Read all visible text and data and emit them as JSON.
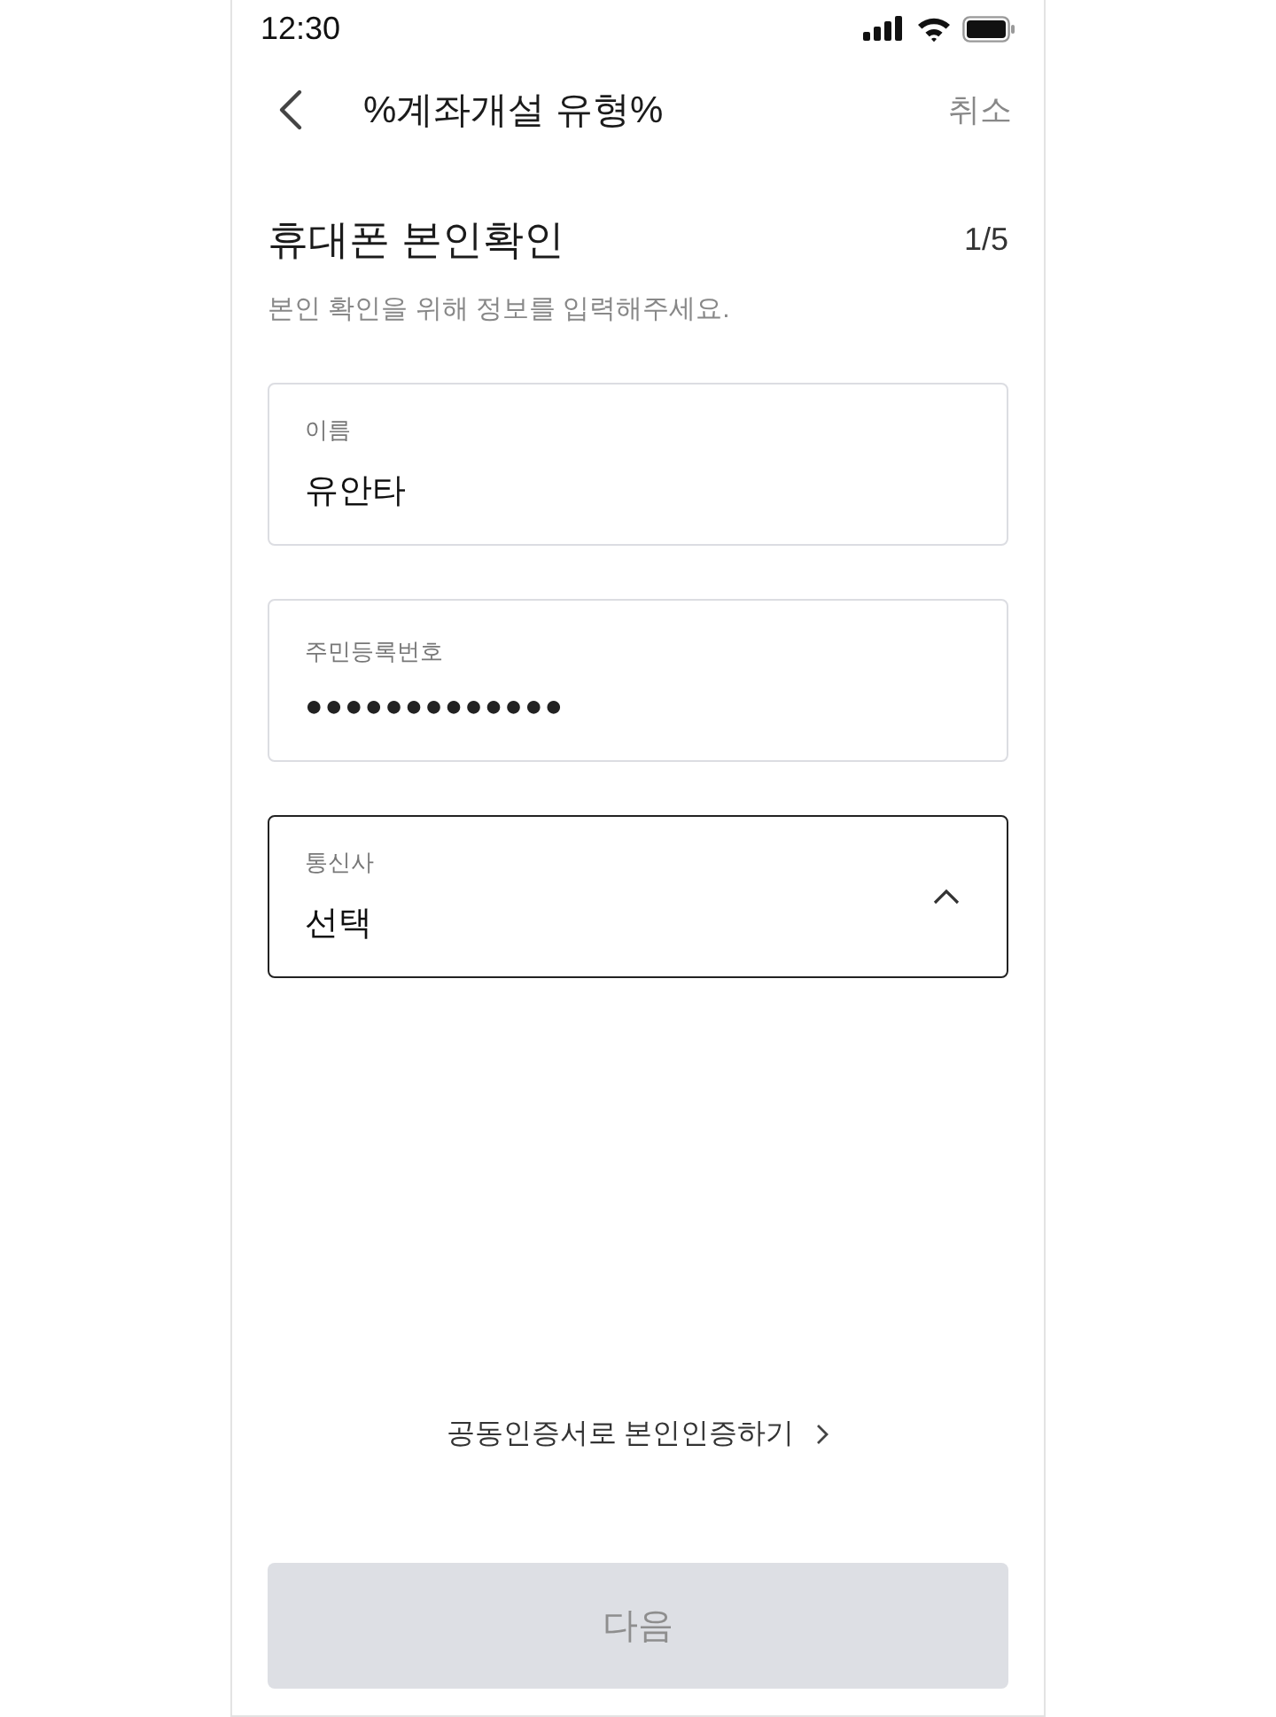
{
  "status_bar": {
    "time": "12:30"
  },
  "header": {
    "title": "%계좌개설 유형%",
    "cancel": "취소"
  },
  "intro": {
    "title": "휴대폰 본인확인",
    "step": "1/5",
    "subtitle": "본인 확인을 위해 정보를 입력해주세요."
  },
  "fields": [
    {
      "kind": "text",
      "label": "이름",
      "value": "유안타",
      "focused": false
    },
    {
      "kind": "masked",
      "label": "주민등록번호",
      "value": "●●●●●●●●●●●●●",
      "focused": false
    },
    {
      "kind": "select",
      "label": "통신사",
      "value": "선택",
      "focused": true,
      "expanded": true
    }
  ],
  "alt_link": {
    "label": "공동인증서로 본인인증하기"
  },
  "next_button": {
    "label": "다음",
    "disabled": true
  }
}
